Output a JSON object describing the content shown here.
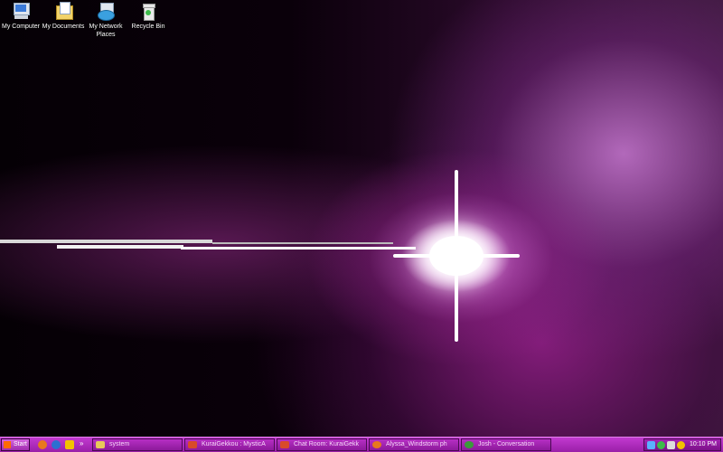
{
  "desktop_icons": [
    {
      "label": "My Computer",
      "icon": "my-computer-icon"
    },
    {
      "label": "My Documents",
      "icon": "my-documents-icon"
    },
    {
      "label": "My Network Places",
      "icon": "network-places-icon"
    },
    {
      "label": "Recycle Bin",
      "icon": "recycle-bin-icon"
    }
  ],
  "taskbar": {
    "start_label": "Start",
    "quick_launch": [
      {
        "icon": "firefox-icon",
        "color": "#e8781c"
      },
      {
        "icon": "outlook-icon",
        "color": "#2c6fd1"
      },
      {
        "icon": "aim-icon",
        "color": "#f2c200"
      }
    ],
    "chevron": "»",
    "tasks": [
      {
        "label": "system",
        "icon": "folder-icon",
        "color": "#e8c85a"
      },
      {
        "label": "KuraiGekkou : MysticA",
        "icon": "chat-window-icon",
        "color": "#d94a2a"
      },
      {
        "label": "Chat Room: KuraiGekk",
        "icon": "chat-window-icon",
        "color": "#d94a2a"
      },
      {
        "label": "Alyssa_Windstorm ph",
        "icon": "firefox-icon",
        "color": "#e8781c"
      },
      {
        "label": "Josh - Conversation",
        "icon": "messenger-icon",
        "color": "#3a9a3a"
      }
    ],
    "tray": [
      {
        "icon": "network-tray-icon",
        "color": "#5ab0ff"
      },
      {
        "icon": "messenger-tray-icon",
        "color": "#3dbb4a"
      },
      {
        "icon": "volume-tray-icon",
        "color": "#dddddd"
      },
      {
        "icon": "aim-tray-icon",
        "color": "#f2c200"
      }
    ],
    "clock": "10:10 PM"
  }
}
